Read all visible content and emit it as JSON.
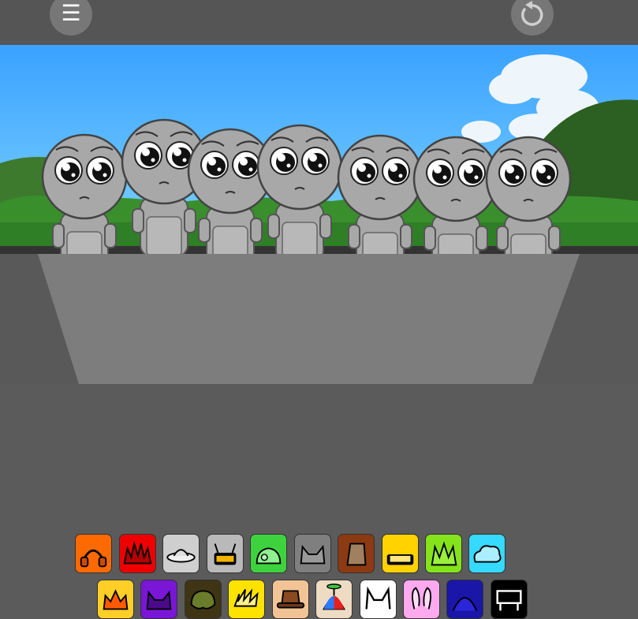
{
  "topbar": {
    "menu_glyph": "☰",
    "menu_icon": "hamburger-menu-icon",
    "reset_icon": "reload-icon",
    "background": "#555555"
  },
  "stage": {
    "sky_colors": [
      "#40a7ff",
      "#79d0ff"
    ],
    "grass_color": "#3a8f2d",
    "character_count": 7,
    "character_color": "#a8a8a8"
  },
  "icons": {
    "row1": [
      {
        "name": "orange-headphones",
        "bg": "#ff6a00"
      },
      {
        "name": "red-spikes",
        "bg": "#ee0000"
      },
      {
        "name": "gray-ufo",
        "bg": "#cfcfcf"
      },
      {
        "name": "gray-antenna-box",
        "bg": "#b9b9b9"
      },
      {
        "name": "green-slime",
        "bg": "#3ed33e"
      },
      {
        "name": "gray-cat-ears",
        "bg": "#7f7f7f"
      },
      {
        "name": "brown-hat",
        "bg": "#8b3a12"
      },
      {
        "name": "yellow-visor",
        "bg": "#ffd200"
      },
      {
        "name": "lime-hair",
        "bg": "#84e31a"
      },
      {
        "name": "cyan-cloud",
        "bg": "#36d9ff"
      }
    ],
    "row2": [
      {
        "name": "yellow-crown",
        "bg": "#ffcf28"
      },
      {
        "name": "purple-horns",
        "bg": "#7a16d6"
      },
      {
        "name": "olive-bush",
        "bg": "#3f3514"
      },
      {
        "name": "yellow-lightning",
        "bg": "#ffe300"
      },
      {
        "name": "tan-fedora",
        "bg": "#f2c495"
      },
      {
        "name": "propeller-cap",
        "bg": "#eddcc3"
      },
      {
        "name": "white-cat-ears",
        "bg": "#ffffff"
      },
      {
        "name": "pink-bunny-ears",
        "bg": "#ffaaee"
      },
      {
        "name": "blue-dome",
        "bg": "#1a16a8"
      },
      {
        "name": "black-screen",
        "bg": "#000000"
      }
    ]
  }
}
